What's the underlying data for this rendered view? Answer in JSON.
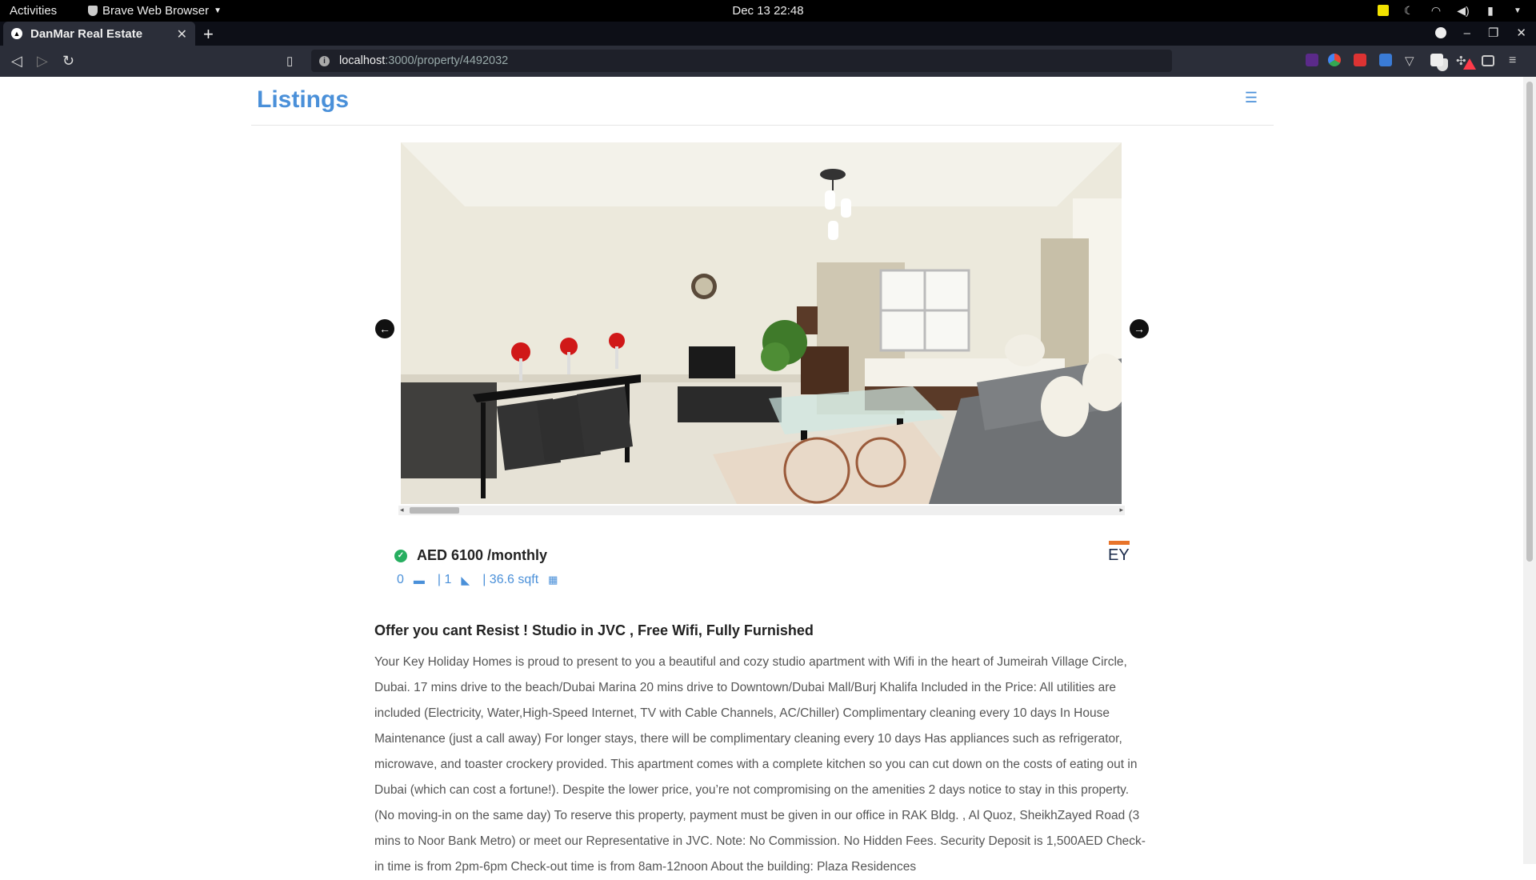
{
  "topbar": {
    "activities": "Activities",
    "app_name": "Brave Web Browser",
    "clock": "Dec 13  22:48"
  },
  "browser": {
    "tab_title": "DanMar Real Estate",
    "url_host": "localhost",
    "url_path": ":3000/property/4492032"
  },
  "site": {
    "brand": "Listings"
  },
  "listing": {
    "price": "AED 6100 /monthly",
    "bedrooms": "0",
    "bathrooms": "| 1",
    "area": "| 36.6 sqft",
    "title": "Offer you cant Resist ! Studio in JVC , Free Wifi, Fully Furnished",
    "description": "Your Key Holiday Homes is proud to present to you a beautiful and cozy studio apartment with Wifi in the heart of Jumeirah Village Circle, Dubai. 17 mins drive to the beach/Dubai Marina 20 mins drive to Downtown/Dubai Mall/Burj Khalifa Included in the Price: All utilities are included (Electricity, Water,High-Speed Internet, TV with Cable Channels, AC/Chiller) Complimentary cleaning every 10 days In House Maintenance (just a call away) For longer stays, there will be complimentary cleaning every 10 days Has appliances such as refrigerator, microwave, and toaster crockery provided. This apartment comes with a complete kitchen so you can cut down on the costs of eating out in Dubai (which can cost a fortune!). Despite the lower price, you’re not compromising on the amenities 2 days notice to stay in this property. (No moving-in on the same day) To reserve this property, payment must be given in our office in RAK Bldg. , Al Quoz, SheikhZayed Road (3 mins to Noor Bank Metro) or meet our Representative in JVC. Note: No Commission. No Hidden Fees. Security Deposit is 1,500AED Check-in time is from 2pm-6pm Check-out time is from 8am-12noon About the building: Plaza Residences"
  },
  "colors": {
    "accent": "#4a90d9",
    "verified": "#27ae60"
  }
}
